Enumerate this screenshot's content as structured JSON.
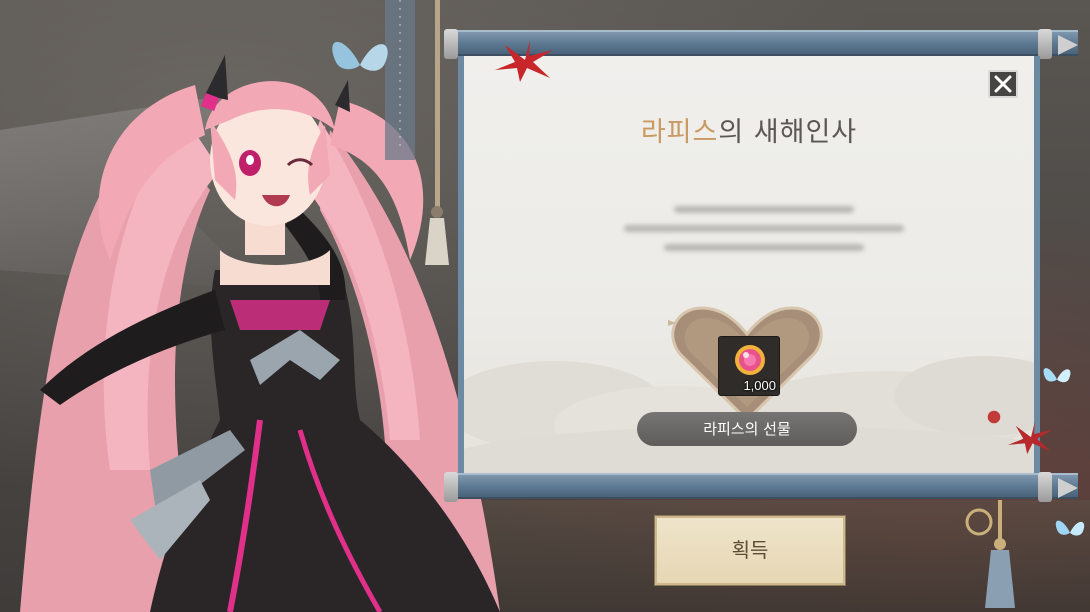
{
  "dialog": {
    "title_highlight": "라피스",
    "title_rest": "의 새해인사",
    "close_icon": "close-icon"
  },
  "reward": {
    "item_icon": "gem-icon",
    "count": "1,000",
    "label": "라피스의 선물"
  },
  "actions": {
    "obtain_label": "획득"
  },
  "colors": {
    "scroll_rod": "#5e7a93",
    "paper": "#efeeeb",
    "title_accent": "#c99a62",
    "button_bg": "#ebdfc1",
    "character_hair": "#f2a9b6",
    "dress_accent": "#e0308a"
  }
}
